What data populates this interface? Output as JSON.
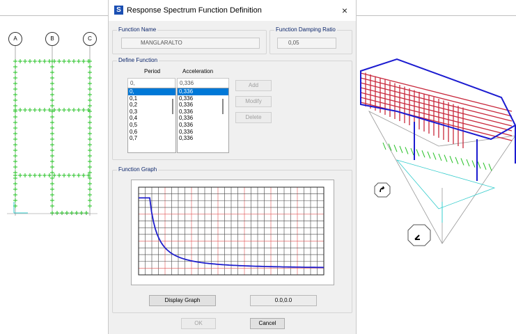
{
  "window": {
    "title": "Response Spectrum  Function Definition",
    "app_icon_letter": "S",
    "close_glyph": "×"
  },
  "function_name": {
    "label": "Function Name",
    "value": "MANGLARALTO"
  },
  "damping": {
    "label": "Function Damping Ratio",
    "value": "0,05"
  },
  "define_function": {
    "label": "Define Function",
    "period_header": "Period",
    "accel_header": "Acceleration",
    "period_input": "0,",
    "accel_input": "0,336",
    "periods": [
      "0,",
      "0,1",
      "0,2",
      "0,3",
      "0,4",
      "0,5",
      "0,6",
      "0,7"
    ],
    "accelerations": [
      "0,336",
      "0,336",
      "0,336",
      "0,336",
      "0,336",
      "0,336",
      "0,336",
      "0,336"
    ],
    "add_label": "Add",
    "modify_label": "Modify",
    "delete_label": "Delete"
  },
  "graph": {
    "label": "Function Graph",
    "display_button": "Display Graph",
    "status_value": "0.0,0.0",
    "curve_color": "#1e1ecc",
    "grid_major_color": "#e05050",
    "grid_minor_color": "#444444"
  },
  "footer": {
    "ok_label": "OK",
    "cancel_label": "Cancel"
  },
  "background": {
    "grid_labels": [
      "A",
      "B",
      "C"
    ],
    "model_color_frame": "#c8283c",
    "model_color_beam": "#1b1bd0",
    "support_color": "#22c022"
  }
}
